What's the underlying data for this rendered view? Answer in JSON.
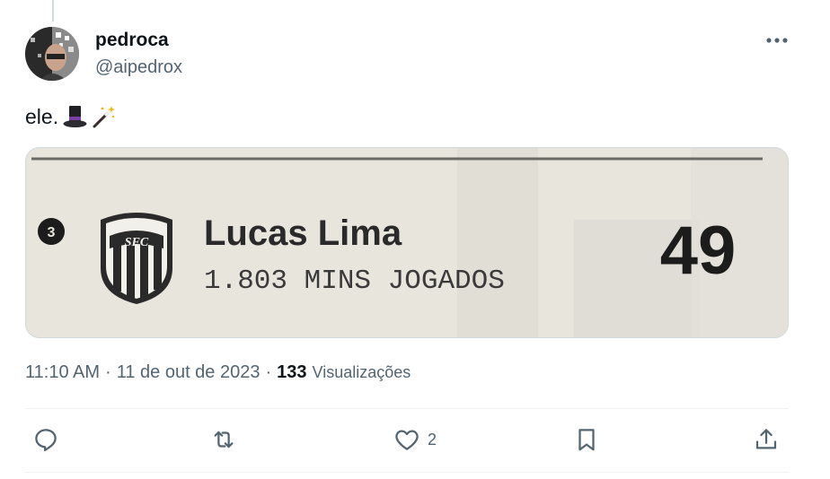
{
  "author": {
    "name": "pedroca",
    "handle": "@aipedrox"
  },
  "post": {
    "text": "ele.",
    "emojis": [
      "top-hat",
      "magic-wand"
    ]
  },
  "media": {
    "rank": "3",
    "player_name": "Lucas Lima",
    "stat_line": "1.803 MINS JOGADOS",
    "value": "49",
    "crest": "santos-crest"
  },
  "meta": {
    "time": "11:10 AM",
    "date": "11 de out de 2023",
    "views_count": "133",
    "views_label": "Visualizações",
    "separator": "·"
  },
  "actions": {
    "reply_count": "",
    "repost_count": "",
    "like_count": "2"
  },
  "colors": {
    "text_primary": "#0f1419",
    "text_secondary": "#536471",
    "border": "#cfd9de",
    "media_bg": "#e6e4da"
  }
}
